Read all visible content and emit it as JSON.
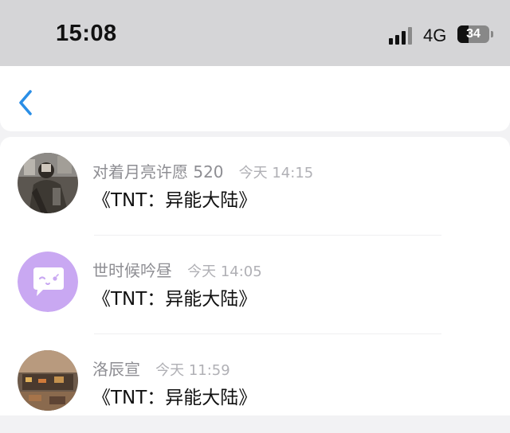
{
  "status_bar": {
    "time": "15:08",
    "network": "4G",
    "battery_percent": "34",
    "battery_level": 0.34
  },
  "nav": {
    "back_icon": "chevron-left-icon",
    "accent_color": "#2a8ee6"
  },
  "notifications": [
    {
      "name": "对着月亮许愿 520",
      "time": "今天 14:15",
      "message": "《TNT：异能大陆》",
      "avatar": "photo-avatar"
    },
    {
      "name": "世时候吟昼",
      "time": "今天 14:05",
      "message": "《TNT：异能大陆》",
      "avatar": "default-chat-bubble-avatar",
      "avatar_color": "#c9a8f2"
    },
    {
      "name": "洛辰宣",
      "time": "今天 11:59",
      "message": "《TNT：异能大陆》",
      "avatar": "photo-avatar"
    }
  ]
}
